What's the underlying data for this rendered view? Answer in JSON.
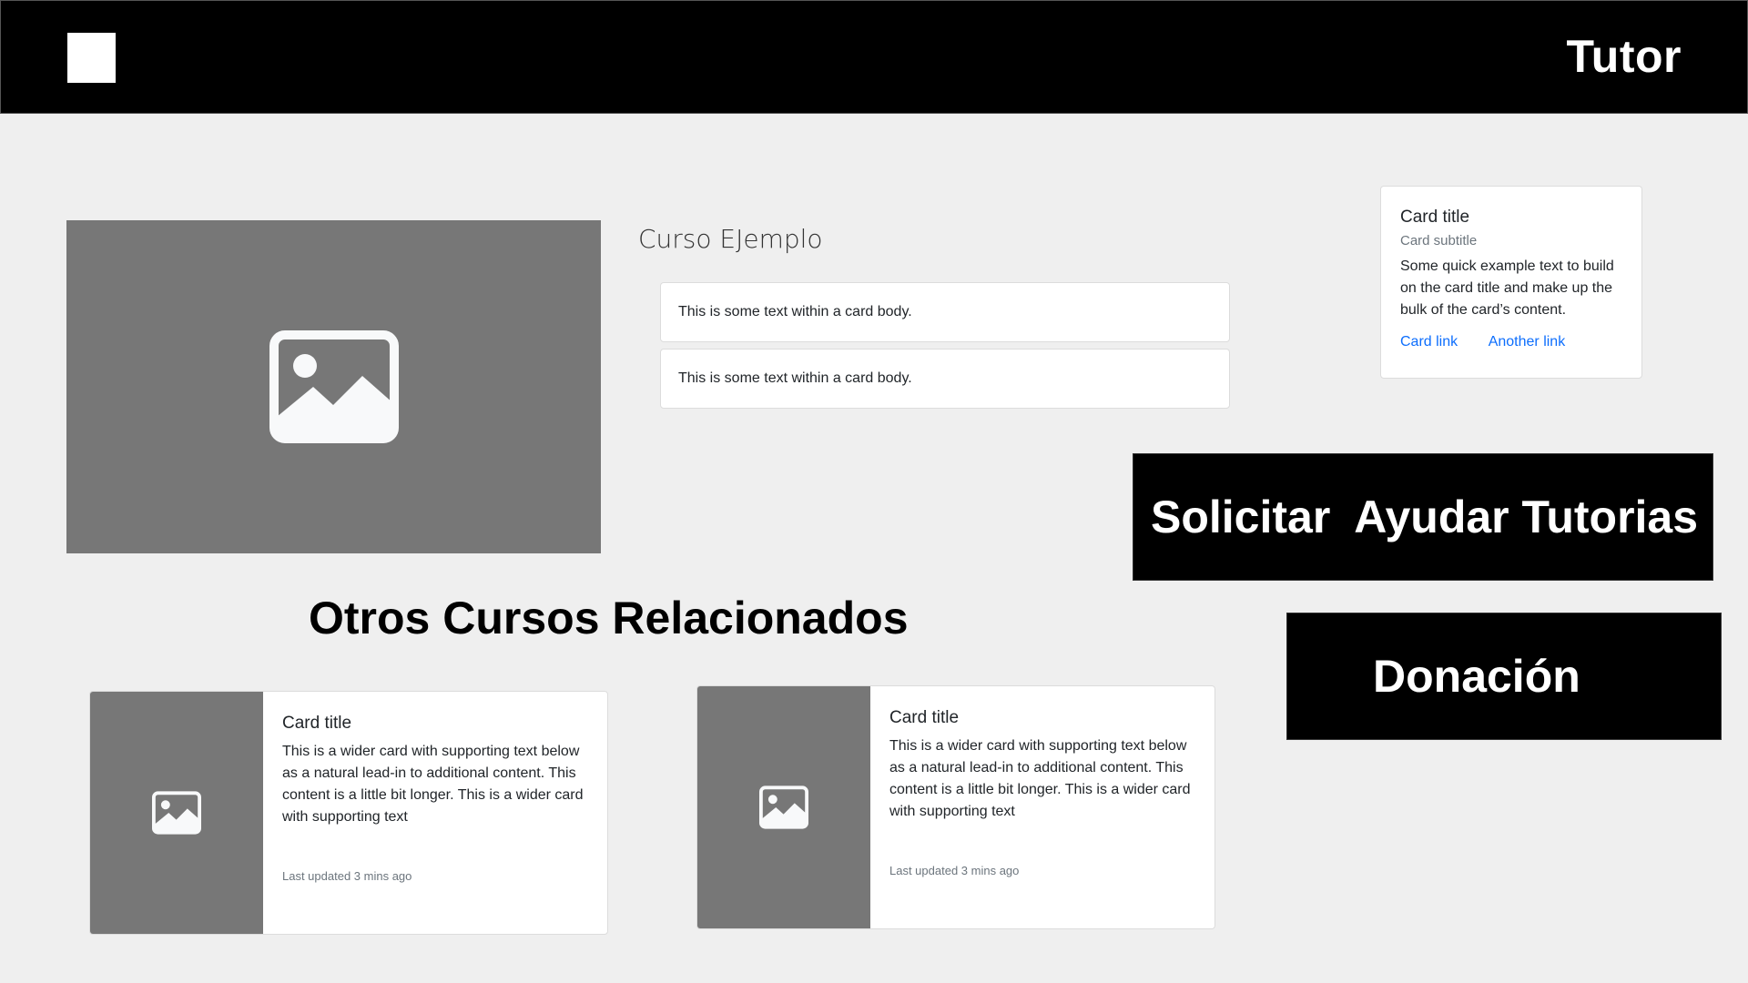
{
  "header": {
    "brand": "Tutor",
    "logo_icon": "logo-square-icon"
  },
  "course": {
    "title": "Curso EJemplo",
    "image_icon": "image-icon",
    "cards": [
      "This is some text within a card body.",
      "This is some text within a card body."
    ]
  },
  "side_card": {
    "title": "Card title",
    "subtitle": "Card subtitle",
    "text": "Some quick example text to build on the card title and make up the bulk of the card’s content.",
    "link1": "Card link",
    "link2": "Another link"
  },
  "actions": {
    "solicitar": "Solicitar  Ayudar Tutorias",
    "donacion": "Donación"
  },
  "related": {
    "title": "Otros Cursos Relacionados",
    "cards": [
      {
        "title": "Card title",
        "text": "This is a wider card with supporting text below as a natural lead-in to additional content. This content is a little bit longer. This is a wider card with supporting text",
        "updated": "Last updated 3 mins ago"
      },
      {
        "title": "Card title",
        "text": "This is a wider card with supporting text below as a natural lead-in to additional content. This content is a little bit longer. This is a wider card with supporting text",
        "updated": "Last updated 3 mins ago"
      }
    ]
  },
  "colors": {
    "header_bg": "#000000",
    "page_bg": "#efefef",
    "placeholder_gray": "#777777",
    "link": "#0d6efd"
  }
}
